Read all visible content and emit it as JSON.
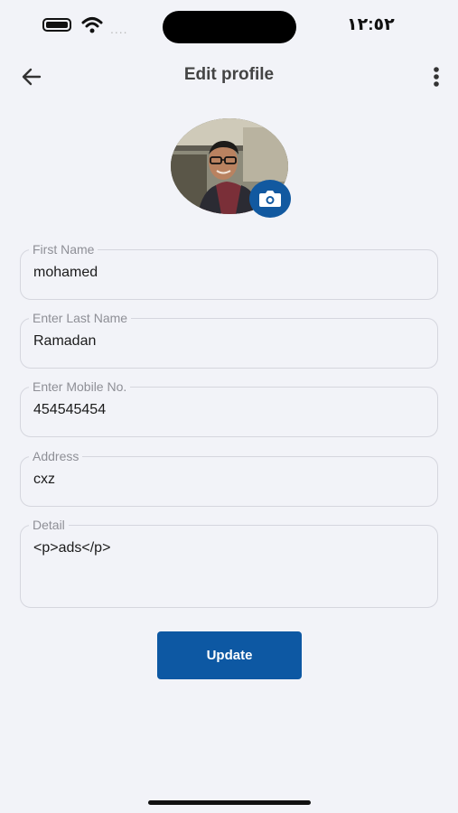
{
  "status_bar": {
    "time": "١٢:٥٢",
    "signal_dots": "....",
    "icons": [
      "battery-icon",
      "wifi-icon"
    ]
  },
  "header": {
    "title": "Edit profile",
    "icons": [
      "back-arrow-icon",
      "more-vertical-icon"
    ]
  },
  "avatar": {
    "icon": "camera-icon"
  },
  "fields": {
    "first_name": {
      "label": "First Name",
      "value": "mohamed"
    },
    "last_name": {
      "label": "Enter Last Name",
      "value": "Ramadan"
    },
    "mobile": {
      "label": "Enter Mobile No.",
      "value": "454545454"
    },
    "address": {
      "label": "Address",
      "value": "cxz"
    },
    "detail": {
      "label": "Detail",
      "value": "<p>ads</p>"
    }
  },
  "actions": {
    "update_label": "Update"
  },
  "colors": {
    "primary": "#0d58a3",
    "background": "#f2f3f8",
    "border": "#d5d6de",
    "label": "#8e8f96"
  }
}
